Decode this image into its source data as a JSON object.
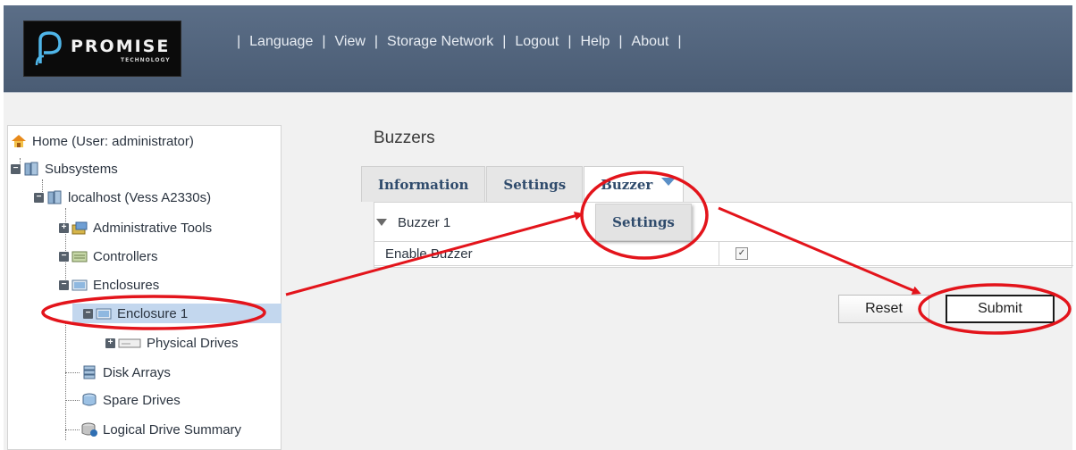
{
  "header": {
    "logo_text": "PROMISE",
    "logo_sub": "TECHNOLOGY",
    "nav": [
      "Language",
      "View",
      "Storage Network",
      "Logout",
      "Help",
      "About"
    ]
  },
  "tree": {
    "home": "Home (User: administrator)",
    "subsystems": "Subsystems",
    "localhost": "localhost (Vess A2330s)",
    "admin_tools": "Administrative Tools",
    "controllers": "Controllers",
    "enclosures": "Enclosures",
    "enclosure1": "Enclosure 1",
    "physical_drives": "Physical Drives",
    "disk_arrays": "Disk Arrays",
    "spare_drives": "Spare Drives",
    "logical_summary": "Logical Drive Summary"
  },
  "main": {
    "title": "Buzzers",
    "tabs": [
      "Information",
      "Settings",
      "Buzzer"
    ],
    "dropdown_item": "Settings",
    "section": "Buzzer 1",
    "enable_label": "Enable Buzzer",
    "enable_checked": true,
    "reset_label": "Reset",
    "submit_label": "Submit"
  },
  "colors": {
    "header": "#4f6179",
    "annotation": "#e3141b",
    "selected": "#c3d7ee"
  }
}
